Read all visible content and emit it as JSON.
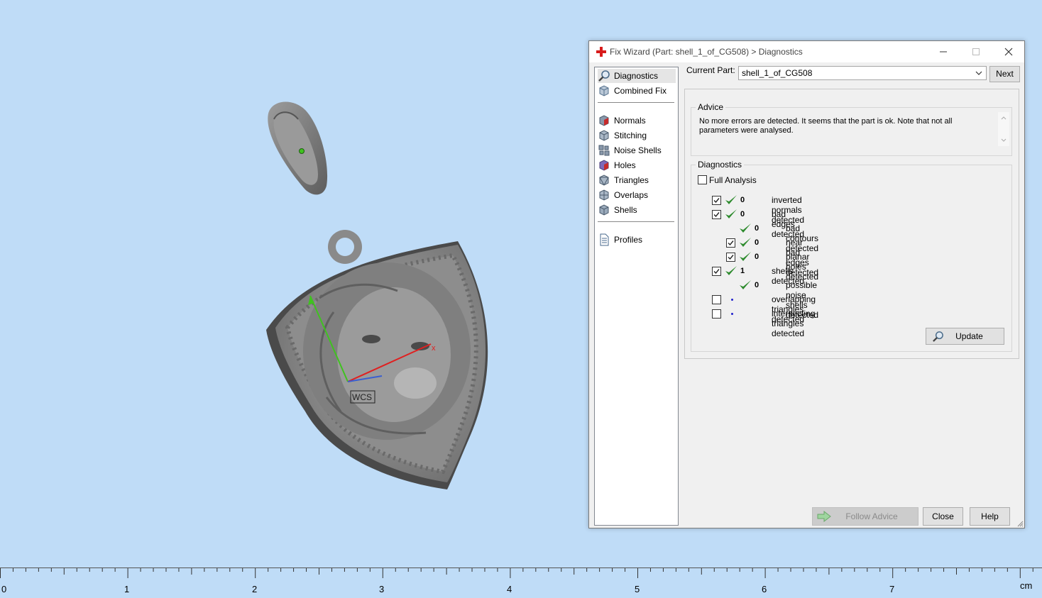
{
  "viewport": {
    "wcs_label": "WCS",
    "axis_x_label": "x",
    "colors": {
      "background": "#bfdcf7",
      "model": "#8e8e8e",
      "x_axis": "#e02020",
      "y_axis": "#3fc21f",
      "z_axis": "#3a5fd0"
    }
  },
  "ruler": {
    "labels": [
      "0",
      "1",
      "2",
      "3",
      "4",
      "5",
      "6",
      "7"
    ],
    "unit": "cm"
  },
  "dialog": {
    "title": "Fix Wizard (Part: shell_1_of_CG508) > Diagnostics",
    "title_icon": "red-cross-icon",
    "nav": {
      "top_items": [
        {
          "label": "Diagnostics",
          "icon": "magnifier-icon",
          "selected": true
        },
        {
          "label": "Combined Fix",
          "icon": "cube-icon",
          "selected": false
        }
      ],
      "fix_items": [
        {
          "label": "Normals",
          "icon": "normals-cube-icon"
        },
        {
          "label": "Stitching",
          "icon": "stitching-cube-icon"
        },
        {
          "label": "Noise Shells",
          "icon": "noise-shells-icon"
        },
        {
          "label": "Holes",
          "icon": "holes-cube-icon"
        },
        {
          "label": "Triangles",
          "icon": "triangles-cube-icon"
        },
        {
          "label": "Overlaps",
          "icon": "overlaps-cube-icon"
        },
        {
          "label": "Shells",
          "icon": "shells-cube-icon"
        }
      ],
      "bottom_items": [
        {
          "label": "Profiles",
          "icon": "document-icon"
        }
      ]
    },
    "current_part": {
      "label": "Current Part:",
      "value": "shell_1_of_CG508"
    },
    "next_label": "Next",
    "advice": {
      "legend": "Advice",
      "text": "No more errors are detected. It seems that the part is ok. Note that not all parameters were analysed."
    },
    "diagnostics": {
      "legend": "Diagnostics",
      "full_analysis_label": "Full Analysis",
      "full_analysis_checked": false,
      "rows": [
        {
          "label": "inverted normals detected",
          "count": "0",
          "checked": true,
          "has_checkbox": true,
          "status": "ok",
          "indent": 0
        },
        {
          "label": "bad edges detected",
          "count": "0",
          "checked": true,
          "has_checkbox": true,
          "status": "ok",
          "indent": 0
        },
        {
          "label": "bad contours detected",
          "count": "0",
          "checked": false,
          "has_checkbox": false,
          "status": "ok",
          "indent": 1
        },
        {
          "label": "near bad edges detected",
          "count": "0",
          "checked": true,
          "has_checkbox": true,
          "status": "ok",
          "indent": 1
        },
        {
          "label": "planar holes detected",
          "count": "0",
          "checked": true,
          "has_checkbox": true,
          "status": "ok",
          "indent": 1
        },
        {
          "label": "shells detected",
          "count": "1",
          "checked": true,
          "has_checkbox": true,
          "status": "ok",
          "indent": 0
        },
        {
          "label": "possible noise shells detected",
          "count": "0",
          "checked": false,
          "has_checkbox": false,
          "status": "ok",
          "indent": 1
        },
        {
          "label": "overlapping triangles detected",
          "count": "",
          "checked": false,
          "has_checkbox": true,
          "status": "not-analysed",
          "indent": 0
        },
        {
          "label": "intersecting triangles detected",
          "count": "",
          "checked": false,
          "has_checkbox": true,
          "status": "not-analysed",
          "indent": 0
        }
      ],
      "update_label": "Update"
    },
    "buttons": {
      "follow_advice": "Follow Advice",
      "close": "Close",
      "help": "Help"
    },
    "colors": {
      "tick": "#2e8b2e",
      "title_icon": "#d81b1b"
    }
  }
}
